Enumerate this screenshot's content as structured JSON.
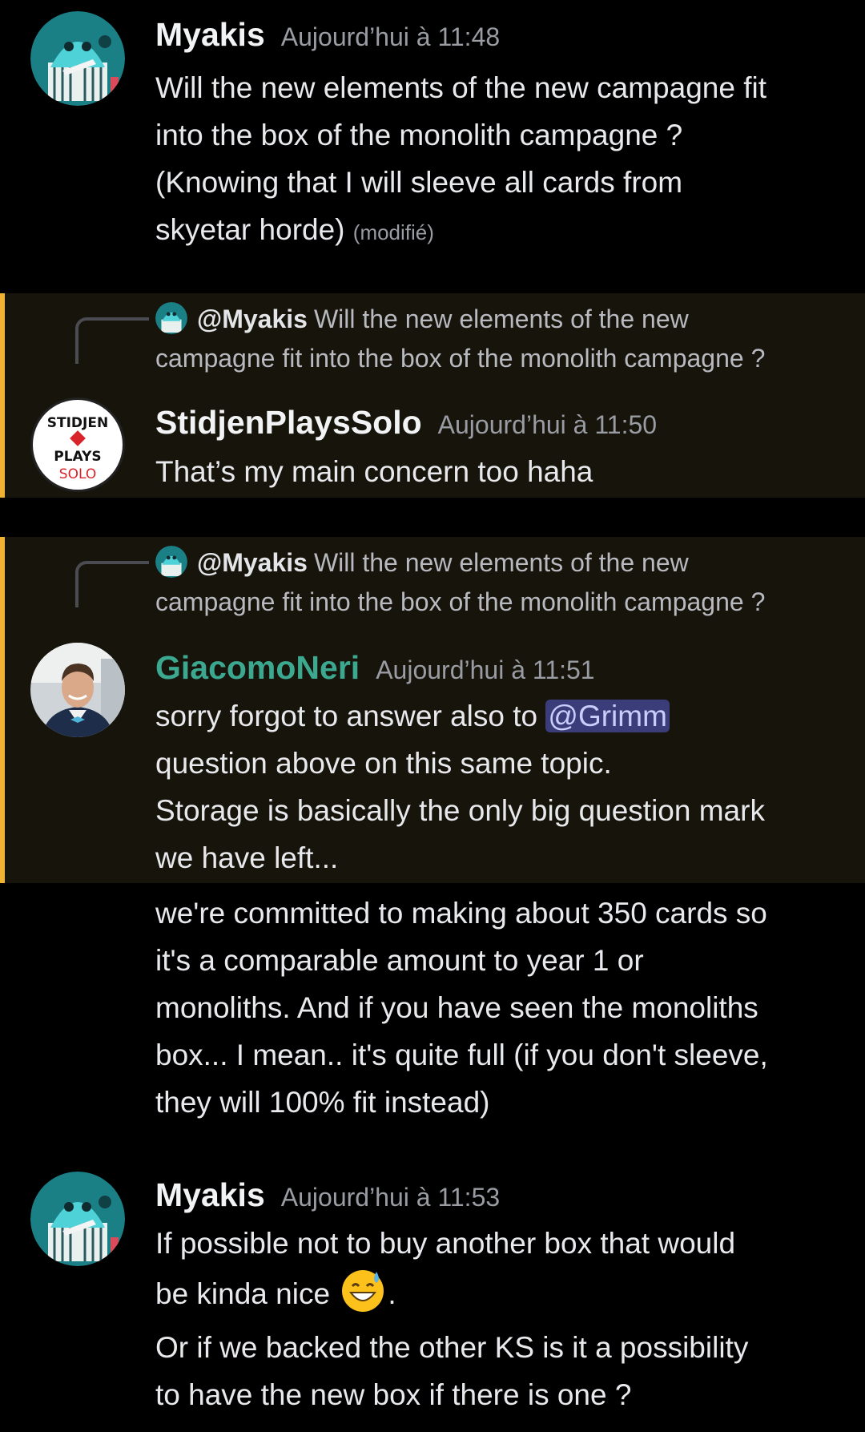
{
  "messages": [
    {
      "author": "Myakis",
      "time": "Aujourd’hui à 11:48",
      "lines": [
        "Will the new elements of the new campagne fit",
        "into the box of the monolith campagne ?",
        "(Knowing that I will sleeve all cards from",
        "skyetar horde)"
      ],
      "edited": "(modifié)"
    },
    {
      "reply": {
        "user": "@Myakis",
        "text_line1": "Will the new elements of the new",
        "text_line2": "campagne fit into the box of the monolith campagne ?"
      },
      "avatar_text": [
        "STIDJEN",
        "PLAYS",
        "SOLO"
      ],
      "author": "StidjenPlaysSolo",
      "time": "Aujourd’hui à 11:50",
      "text": "That’s my main concern too haha"
    },
    {
      "reply": {
        "user": "@Myakis",
        "text_line1": "Will the new elements of the new",
        "text_line2": "campagne fit into the box of the monolith campagne ?"
      },
      "author": "GiacomoNeri",
      "time": "Aujourd’hui à 11:51",
      "line1_prefix": "sorry forgot to answer also to ",
      "mention": "@Grimm",
      "lines": [
        "question above on this same topic.",
        "Storage is basically the only big question mark",
        "we have left..."
      ]
    },
    {
      "continuation": true,
      "lines": [
        "we're committed to making about 350 cards so",
        "it's a comparable amount to year 1 or",
        "monoliths. And if you have seen the monoliths",
        "box... I mean.. it's quite full (if you don't sleeve,",
        "they will 100% fit instead)"
      ]
    },
    {
      "author": "Myakis",
      "time": "Aujourd’hui à 11:53",
      "line1": "If possible not to buy another box that would",
      "line2_prefix": "be kinda nice",
      "line2_suffix": ".",
      "emoji": "grinning-sweat-emoji",
      "paragraph2": [
        "Or if we backed the other KS is it a possibility",
        "to have the new box if there is one ?"
      ]
    }
  ],
  "colors": {
    "background": "#000000",
    "mention_highlight_bg": "#17140b",
    "mention_bar": "#f0b232",
    "giacomo_name": "#3ba88f",
    "mention_pill": "#3b3d7a"
  }
}
